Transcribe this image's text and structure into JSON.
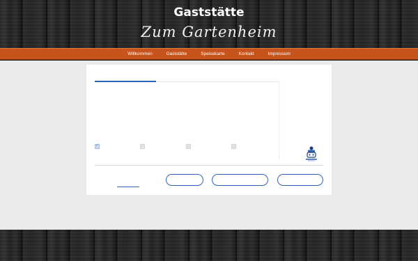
{
  "header": {
    "title": "Gaststätte",
    "subtitle": "Zum Gartenheim"
  },
  "nav": {
    "items": [
      {
        "label": "Willkommen"
      },
      {
        "label": "Gaststätte"
      },
      {
        "label": "Speisekarte"
      },
      {
        "label": "Kontakt"
      },
      {
        "label": "Impressum"
      }
    ]
  },
  "consent": {
    "checkboxes": [
      {
        "checked": true
      },
      {
        "checked": false
      },
      {
        "checked": false
      },
      {
        "checked": false
      }
    ],
    "logo_icon": "consent-provider-logo-icon",
    "accent_color": "#2f63b8"
  },
  "colors": {
    "nav_bar": "#c7531d",
    "content_bg": "#ebebeb",
    "panel_bg": "#ffffff"
  }
}
